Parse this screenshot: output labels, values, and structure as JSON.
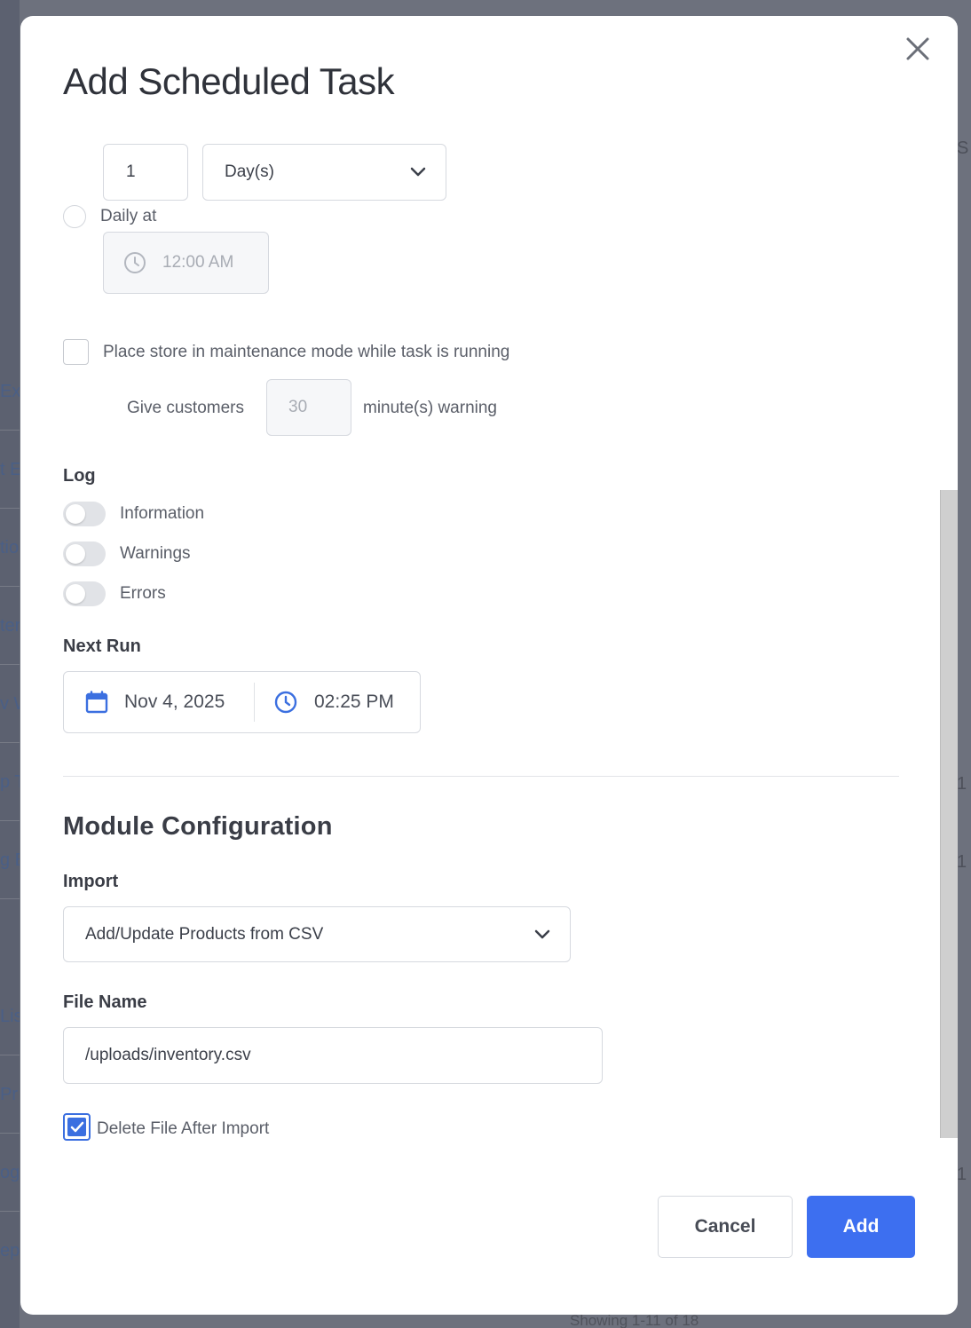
{
  "modal": {
    "title": "Add Scheduled Task"
  },
  "schedule": {
    "interval_value": "1",
    "interval_unit": "Day(s)",
    "daily_label": "Daily at",
    "daily_time": "12:00 AM"
  },
  "maintenance": {
    "checkbox_label": "Place store in maintenance mode while task is running",
    "checked": false,
    "warning_prefix": "Give customers",
    "warning_minutes_placeholder": "30",
    "warning_suffix": "minute(s) warning"
  },
  "log": {
    "heading": "Log",
    "toggles": [
      {
        "label": "Information",
        "on": false
      },
      {
        "label": "Warnings",
        "on": false
      },
      {
        "label": "Errors",
        "on": false
      }
    ]
  },
  "next_run": {
    "heading": "Next Run",
    "date": "Nov 4, 2025",
    "time": "02:25 PM"
  },
  "module": {
    "heading": "Module Configuration",
    "import_label": "Import",
    "import_value": "Add/Update Products from CSV",
    "file_name_label": "File Name",
    "file_name_value": "/uploads/inventory.csv",
    "delete_label": "Delete File After Import",
    "delete_checked": true
  },
  "actions": {
    "cancel_label": "Cancel",
    "add_label": "Add"
  },
  "background": {
    "row_fragments": [
      "Ex",
      "t E",
      "tio",
      "ter",
      "v W",
      "p T",
      "g E",
      "Lis",
      "Pr",
      "og",
      "epo"
    ],
    "right_fragments": [
      "S",
      "1",
      "1",
      "1"
    ],
    "footer": "Showing 1-11 of 18"
  },
  "colors": {
    "accent": "#3d6ff0",
    "icon_blue": "#3b6fe0",
    "overlay": "#5c6170"
  }
}
